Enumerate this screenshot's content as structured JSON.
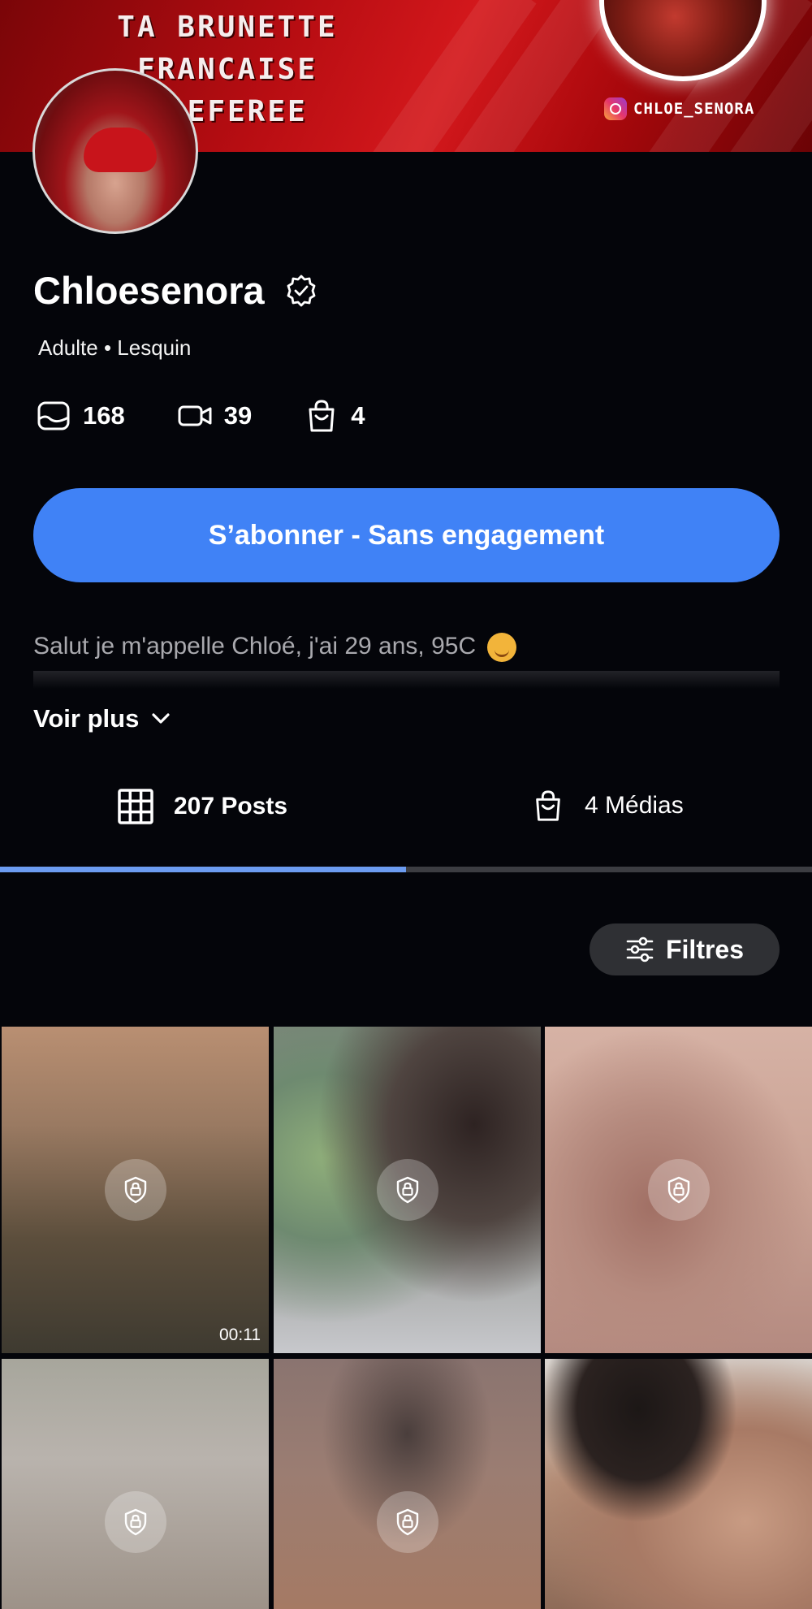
{
  "banner": {
    "title_line1": "TA BRUNETTE FRANCAISE",
    "title_line2": "PREFEREE",
    "instagram_handle": "CHLOE_SENORA"
  },
  "profile": {
    "name": "Chloesenora",
    "meta": "Adulte • Lesquin",
    "stats": {
      "photos": "168",
      "videos": "39",
      "products": "4"
    },
    "subscribe_label": "S’abonner - Sans engagement",
    "bio": "Salut je m'appelle Chloé, j'ai 29 ans, 95C",
    "see_more": "Voir plus"
  },
  "tabs": [
    {
      "label": "207 Posts",
      "active": true
    },
    {
      "label": "4 Médias",
      "active": false
    }
  ],
  "filter_label": "Filtres",
  "grid": {
    "tiles": [
      {
        "locked": true,
        "duration": "00:11"
      },
      {
        "locked": true,
        "duration": ""
      },
      {
        "locked": true,
        "duration": ""
      },
      {
        "locked": true,
        "duration": ""
      },
      {
        "locked": true,
        "duration": ""
      },
      {
        "locked": false,
        "duration": ""
      }
    ]
  },
  "colors": {
    "background": "#04050a",
    "accent": "#4082f6",
    "tab_indicator": "#6c9cf1",
    "banner_red": "#c8141b"
  }
}
